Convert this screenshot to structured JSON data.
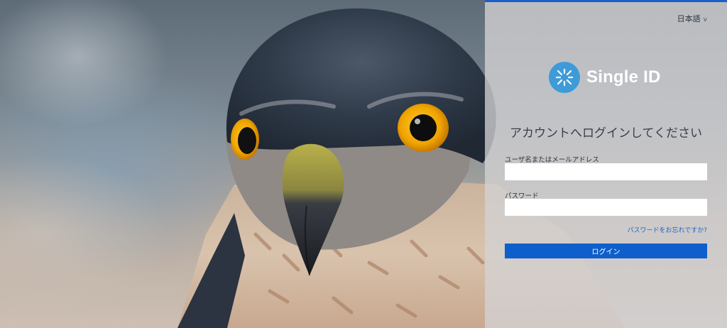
{
  "language_selector": {
    "label": "日本語",
    "chevron": "v"
  },
  "logo": {
    "text": "Single ID",
    "icon": "single-id-logo-icon"
  },
  "heading": "アカウントへログインしてください",
  "form": {
    "username_label": "ユーザ名またはメールアドレス",
    "username_value": "",
    "password_label": "パスワード",
    "password_value": "",
    "forgot_link": "パスワードをお忘れですか?",
    "login_button": "ログイン"
  },
  "colors": {
    "accent": "#0e5fcc",
    "top_bar": "#1a5fc7",
    "logo_circle": "#3e9bd8",
    "link": "#1e66c8"
  },
  "background": {
    "subject": "hawk-photo"
  }
}
